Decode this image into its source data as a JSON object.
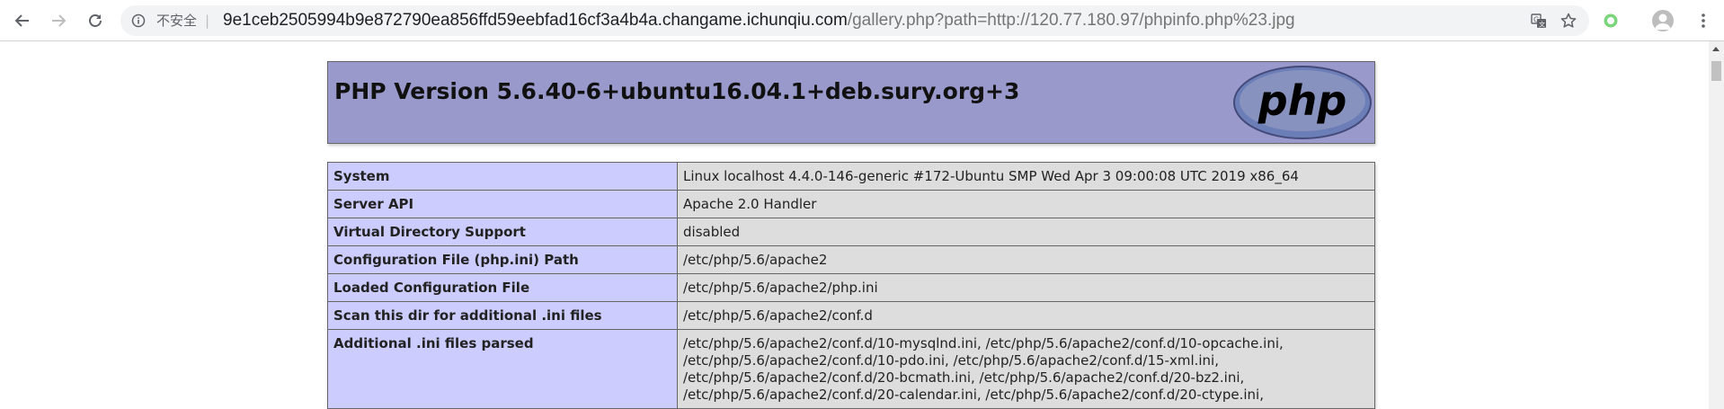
{
  "browser": {
    "security_label": "不安全",
    "separator": "|",
    "url_host": "9e1ceb2505994b9e872790ea856ffd59eebfad16cf3a4b4a.changame.ichunqiu.com",
    "url_path": "/gallery.php?path=http://120.77.180.97/phpinfo.php%23.jpg",
    "icons": [
      "back-arrow-icon",
      "forward-arrow-icon",
      "reload-icon",
      "info-icon",
      "translate-icon",
      "star-icon",
      "extension-icon",
      "avatar-icon",
      "more-menu-icon"
    ]
  },
  "page": {
    "title": "PHP Version 5.6.40-6+ubuntu16.04.1+deb.sury.org+3",
    "logo_text": "php",
    "colors": {
      "header_bg": "#9999cc",
      "key_cell_bg": "#ccccff",
      "value_cell_bg": "#dddddd"
    },
    "rows": [
      {
        "key": "System",
        "value": "Linux localhost 4.4.0-146-generic #172-Ubuntu SMP Wed Apr 3 09:00:08 UTC 2019 x86_64"
      },
      {
        "key": "Server API",
        "value": "Apache 2.0 Handler"
      },
      {
        "key": "Virtual Directory Support",
        "value": "disabled"
      },
      {
        "key": "Configuration File (php.ini) Path",
        "value": "/etc/php/5.6/apache2"
      },
      {
        "key": "Loaded Configuration File",
        "value": "/etc/php/5.6/apache2/php.ini"
      },
      {
        "key": "Scan this dir for additional .ini files",
        "value": "/etc/php/5.6/apache2/conf.d"
      },
      {
        "key": "Additional .ini files parsed",
        "value": "/etc/php/5.6/apache2/conf.d/10-mysqlnd.ini, /etc/php/5.6/apache2/conf.d/10-opcache.ini, /etc/php/5.6/apache2/conf.d/10-pdo.ini, /etc/php/5.6/apache2/conf.d/15-xml.ini, /etc/php/5.6/apache2/conf.d/20-bcmath.ini, /etc/php/5.6/apache2/conf.d/20-bz2.ini, /etc/php/5.6/apache2/conf.d/20-calendar.ini, /etc/php/5.6/apache2/conf.d/20-ctype.ini,"
      }
    ]
  }
}
